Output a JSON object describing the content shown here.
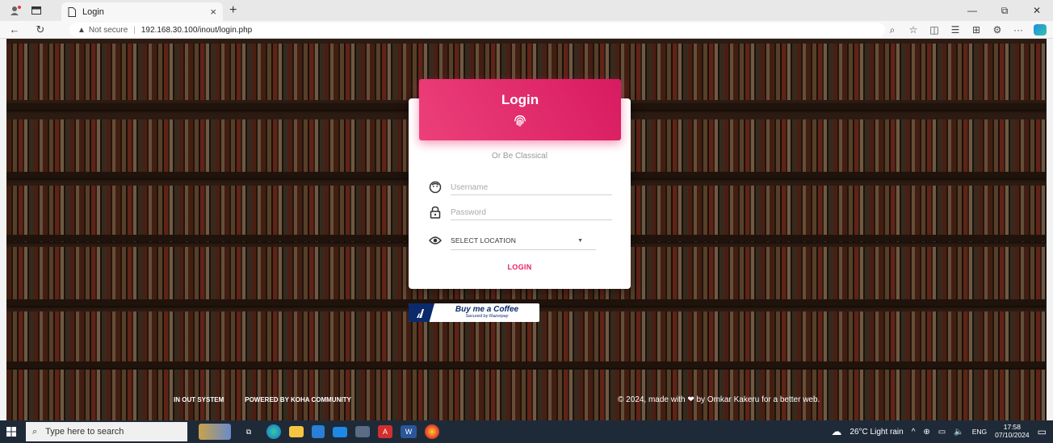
{
  "browser": {
    "tab_title": "Login",
    "tab_close": "×",
    "new_tab": "+",
    "security_label": "Not secure",
    "url": "192.168.30.100/inout/login.php"
  },
  "login": {
    "title": "Login",
    "subtitle": "Or Be Classical",
    "username_placeholder": "Username",
    "password_placeholder": "Password",
    "location_label": "SELECT LOCATION",
    "button_label": "LOGIN",
    "accent_color": "#e91e63"
  },
  "coffee": {
    "label": "Buy me a Coffee",
    "sublabel": "Secured by Razorpay"
  },
  "footer": {
    "link1": "IN OUT SYSTEM",
    "link2": "POWERED BY KOHA COMMUNITY",
    "copyright_prefix": "© 2024, made with",
    "copyright_suffix": "by Omkar Kakeru for a better web."
  },
  "taskbar": {
    "search_placeholder": "Type here to search",
    "weather": "26°C  Light rain",
    "language": "ENG",
    "time": "17:58",
    "date": "07/10/2024"
  }
}
